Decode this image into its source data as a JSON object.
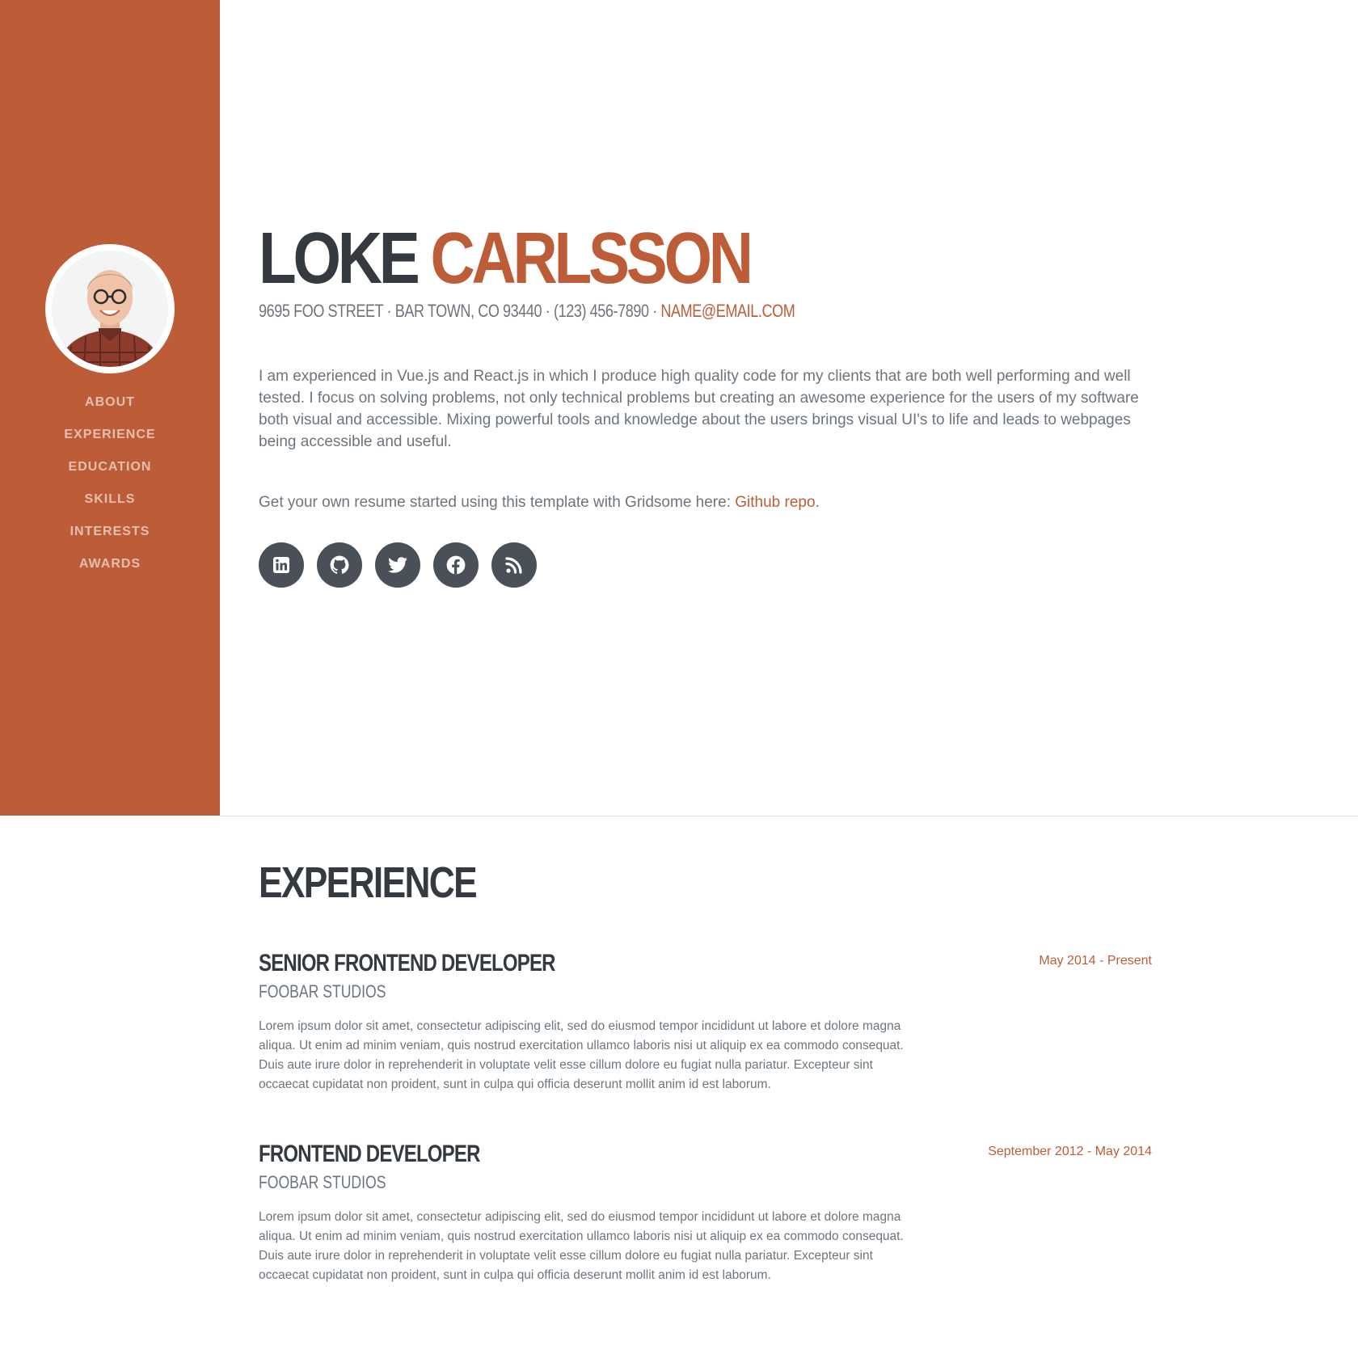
{
  "profile": {
    "first_name": "LOKE",
    "last_name": "CARLSSON",
    "address": "9695 FOO STREET · BAR TOWN, CO 93440 · (123) 456-7890 · ",
    "email": "NAME@EMAIL.COM"
  },
  "nav": {
    "items": [
      "ABOUT",
      "EXPERIENCE",
      "EDUCATION",
      "SKILLS",
      "INTERESTS",
      "AWARDS"
    ]
  },
  "about": {
    "lead": "I am experienced in Vue.js and React.js in which I produce high quality code for my clients that are both well performing and well tested. I focus on solving problems, not only technical problems but creating an awesome experience for the users of my software both visual and accessible. Mixing powerful tools and knowledge about the users brings visual UI's to life and leads to webpages being accessible and useful.",
    "repo_prefix": "Get your own resume started using this template with Gridsome here: ",
    "repo_link": "Github repo",
    "repo_suffix": "."
  },
  "social": [
    "linkedin-icon",
    "github-icon",
    "twitter-icon",
    "facebook-icon",
    "rss-icon"
  ],
  "experience": {
    "title": "EXPERIENCE",
    "jobs": [
      {
        "title": "SENIOR FRONTEND DEVELOPER",
        "company": "FOOBAR STUDIOS",
        "date": "May 2014 - Present",
        "description": "Lorem ipsum dolor sit amet, consectetur adipiscing elit, sed do eiusmod tempor incididunt ut labore et dolore magna aliqua. Ut enim ad minim veniam, quis nostrud exercitation ullamco laboris nisi ut aliquip ex ea commodo consequat. Duis aute irure dolor in reprehenderit in voluptate velit esse cillum dolore eu fugiat nulla pariatur. Excepteur sint occaecat cupidatat non proident, sunt in culpa qui officia deserunt mollit anim id est laborum."
      },
      {
        "title": "FRONTEND DEVELOPER",
        "company": "FOOBAR STUDIOS",
        "date": "September 2012 - May 2014",
        "description": "Lorem ipsum dolor sit amet, consectetur adipiscing elit, sed do eiusmod tempor incididunt ut labore et dolore magna aliqua. Ut enim ad minim veniam, quis nostrud exercitation ullamco laboris nisi ut aliquip ex ea commodo consequat. Duis aute irure dolor in reprehenderit in voluptate velit esse cillum dolore eu fugiat nulla pariatur. Excepteur sint occaecat cupidatat non proident, sunt in culpa qui officia deserunt mollit anim id est laborum."
      }
    ]
  },
  "colors": {
    "primary": "#bd5d38",
    "heading": "#343a40",
    "muted": "#6c757d",
    "social_bg": "#495057"
  }
}
